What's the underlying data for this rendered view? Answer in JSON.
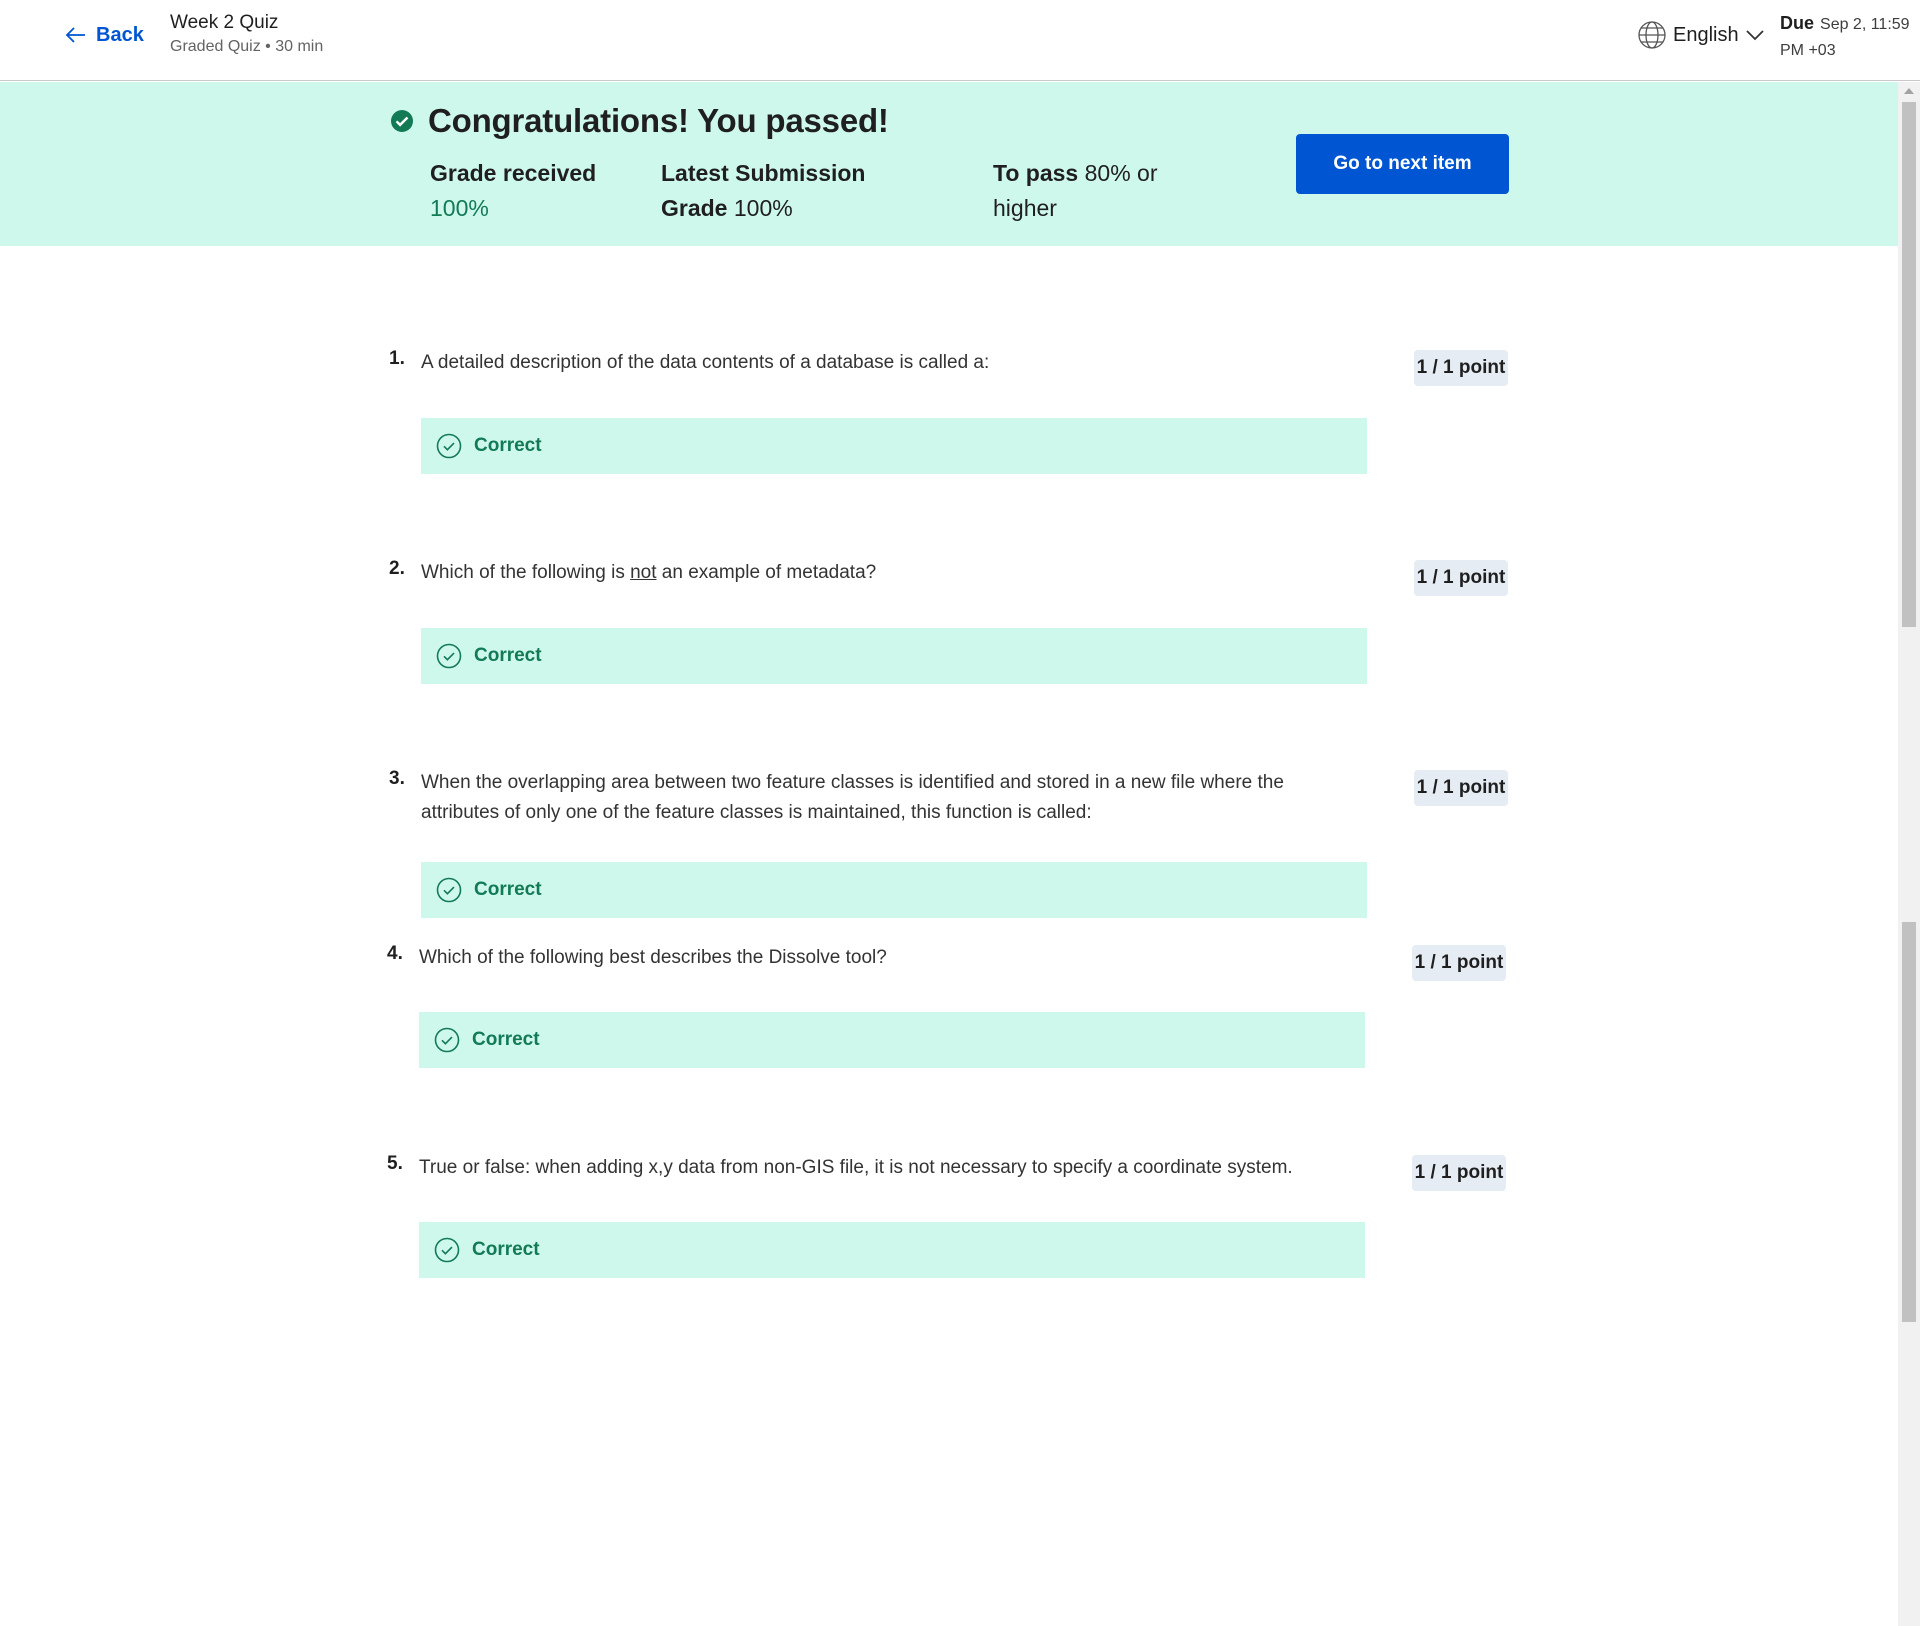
{
  "header": {
    "back_label": "Back",
    "quiz_title": "Week 2 Quiz",
    "quiz_subtitle": "Graded Quiz • 30 min",
    "language": "English",
    "due_label": "Due",
    "due_value": "Sep 2, 11:59 PM +03"
  },
  "banner": {
    "title": "Congratulations! You passed!",
    "grade_label": "Grade received",
    "grade_value": "100%",
    "latest_label": "Latest Submission Grade",
    "latest_value": "100%",
    "pass_label": "To pass",
    "pass_value": "80% or higher",
    "next_button": "Go to next item"
  },
  "questions": [
    {
      "num": "1.",
      "text": "A detailed description of the data contents of a database is called a:",
      "points": "1 / 1 point",
      "feedback": "Correct"
    },
    {
      "num": "2.",
      "text_before": "Which of the following is ",
      "text_emph": "not",
      "text_after": " an example of metadata?",
      "points": "1 / 1 point",
      "feedback": "Correct"
    },
    {
      "num": "3.",
      "text": "When the overlapping area between two feature classes is identified and stored in a new file where the attributes of only one of the feature classes is maintained, this function is called:",
      "points": "1 / 1 point",
      "feedback": "Correct"
    },
    {
      "num": "4.",
      "text": "Which of the following best describes the Dissolve tool?",
      "points": "1 / 1 point",
      "feedback": "Correct"
    },
    {
      "num": "5.",
      "text": "True or false: when adding x,y data from non-GIS file, it is not necessary to specify a coordinate system.",
      "points": "1 / 1 point",
      "feedback": "Correct"
    }
  ],
  "colors": {
    "accent": "#0056d2",
    "success": "#127b56",
    "success_bg": "#cff8ec",
    "points_bg": "#e6ecf4"
  },
  "icons": [
    "arrow-left-icon",
    "globe-icon",
    "chevron-down-icon",
    "check-circle-filled-icon",
    "check-circle-outline-icon"
  ]
}
